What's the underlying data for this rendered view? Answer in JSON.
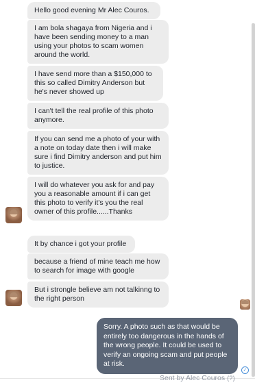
{
  "conversation": {
    "incoming": [
      "Hello good evening Mr Alec Couros.",
      "I am bola shagaya from Nigeria and i have been sending money to a man using your photos to scam women around the world.",
      "I have send more than a $150,000 to this so called Dimitry Anderson but he's never showed up",
      "I can't tell the real profile of this photo anymore.",
      "If you can send me a photo of your with a note on today date then i will make sure i find Dimitry anderson and put him to justice.",
      "I will do whatever you ask for and pay you a reasonable amount if i can get this photo to verify it's you the real owner of this profile......Thanks",
      "It by chance i got your profile",
      "because a friend of mine teach me how to search for image with google",
      "But i strongle believe am not talkinng to the right person"
    ],
    "outgoing": [
      "Sorry. A photo such as that would be entirely too dangerous in the hands of the wrong people. It could be used to verify an ongoing scam and put people at risk."
    ],
    "status": {
      "sent_by": "Sent by Alec Couros",
      "help": "(?)"
    }
  },
  "icons": {
    "avatar": "profile-photo",
    "seen": "seen-check-icon"
  },
  "colors": {
    "incoming_bubble": "#ececec",
    "outgoing_bubble": "#5a6576",
    "status_text": "#9197a3"
  }
}
